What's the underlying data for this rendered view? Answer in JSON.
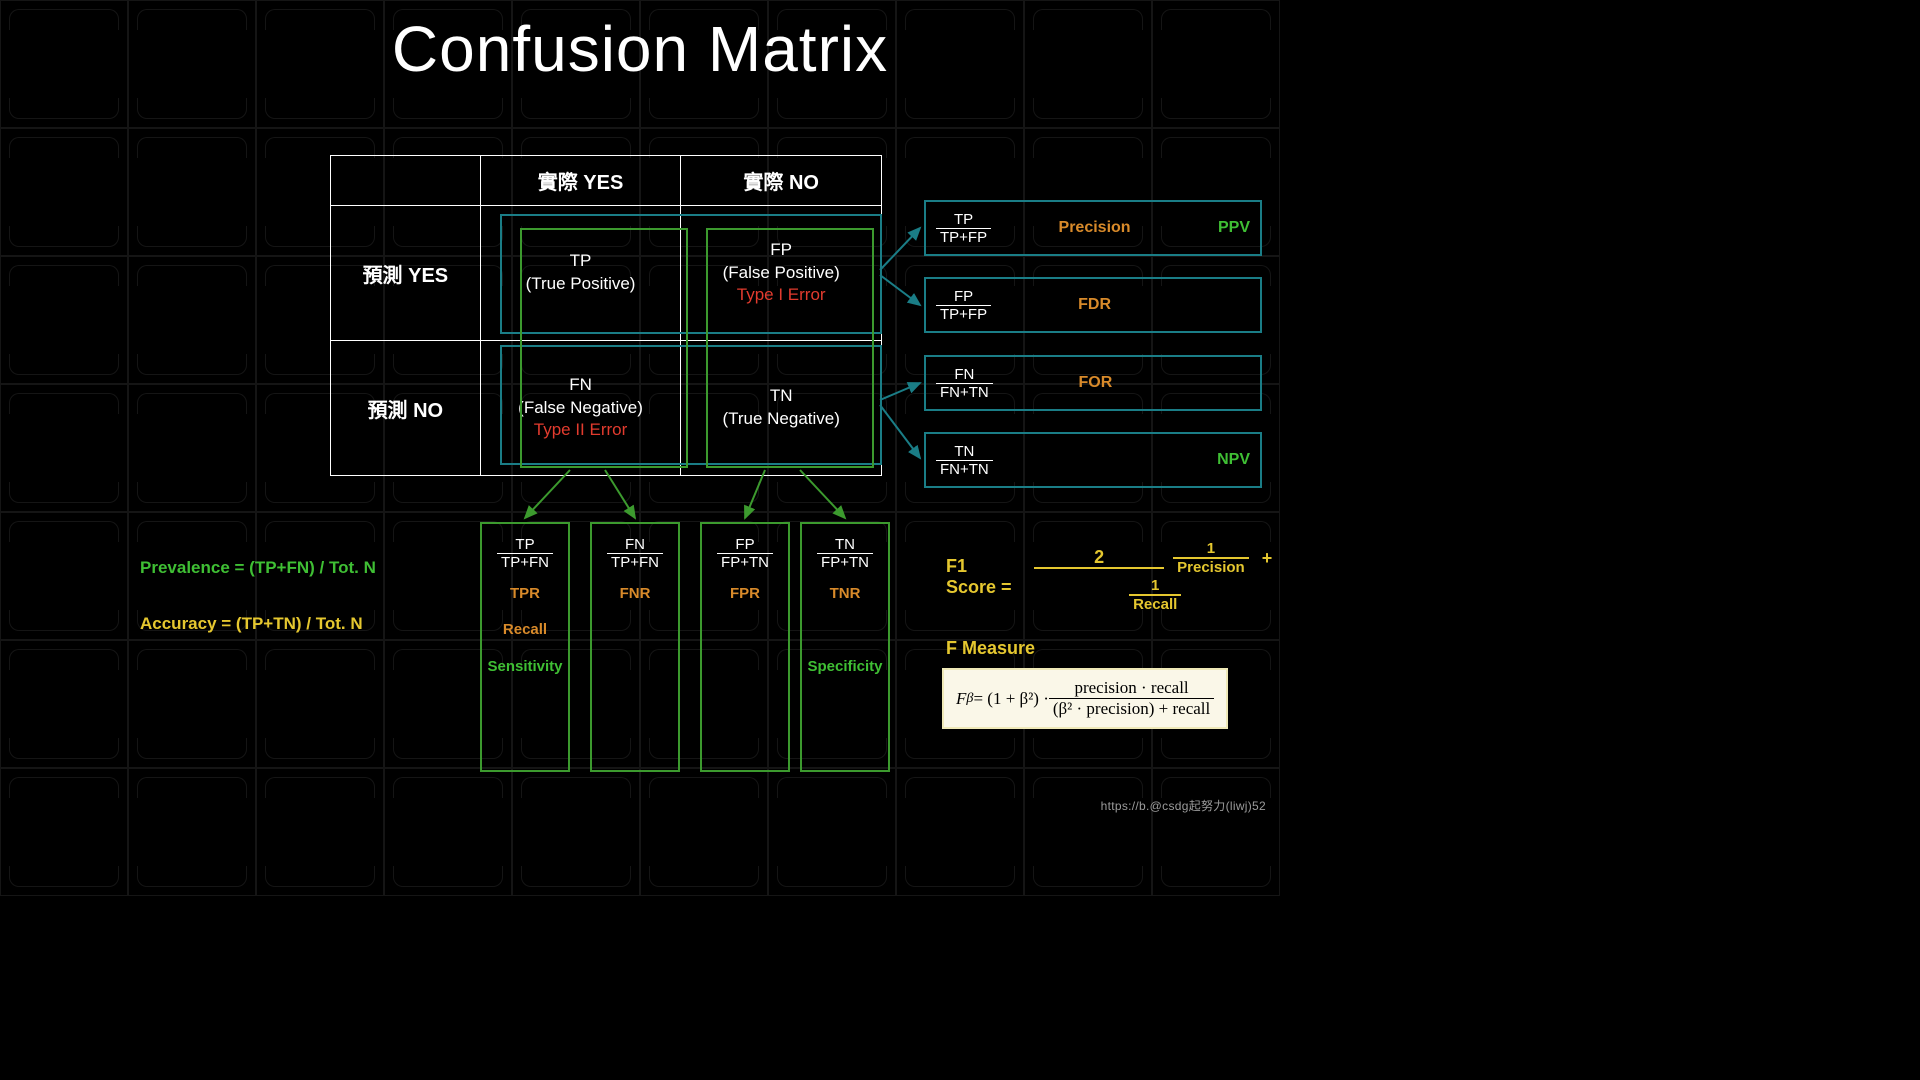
{
  "title": "Confusion Matrix",
  "matrix": {
    "col_headers": [
      "實際 YES",
      "實際 NO"
    ],
    "row_headers": [
      "預測 YES",
      "預測 NO"
    ],
    "cells": {
      "tp_abbr": "TP",
      "tp_full": "(True Positive)",
      "fp_abbr": "FP",
      "fp_full": "(False Positive)",
      "fp_err": "Type I Error",
      "fn_abbr": "FN",
      "fn_full": "(False Negative)",
      "fn_err": "Type II Error",
      "tn_abbr": "TN",
      "tn_full": "(True Negative)"
    }
  },
  "col_metrics": [
    {
      "num": "TP",
      "den": "TP+FN",
      "abbr": "TPR",
      "alt1": "Recall",
      "alt2": "Sensitivity"
    },
    {
      "num": "FN",
      "den": "TP+FN",
      "abbr": "FNR",
      "alt1": "",
      "alt2": ""
    },
    {
      "num": "FP",
      "den": "FP+TN",
      "abbr": "FPR",
      "alt1": "",
      "alt2": ""
    },
    {
      "num": "TN",
      "den": "FP+TN",
      "abbr": "TNR",
      "alt1": "",
      "alt2": "Specificity"
    }
  ],
  "row_metrics": [
    {
      "num": "TP",
      "den": "TP+FP",
      "name": "Precision",
      "name2": "PPV"
    },
    {
      "num": "FP",
      "den": "TP+FP",
      "name": "FDR",
      "name2": ""
    },
    {
      "num": "FN",
      "den": "FN+TN",
      "name": "FOR",
      "name2": ""
    },
    {
      "num": "TN",
      "den": "FN+TN",
      "name": "",
      "name2": "NPV"
    }
  ],
  "side_formulas": {
    "prevalence": "Prevalence = (TP+FN) / Tot. N",
    "accuracy": "Accuracy = (TP+TN) / Tot. N"
  },
  "f1": {
    "label": "F1 Score =",
    "numerator": "2",
    "left_num": "1",
    "left_den": "Precision",
    "right_num": "1",
    "right_den": "Recall",
    "plus": "+"
  },
  "fmeasure": {
    "label": "F Measure",
    "lhs": "F",
    "sub": "β",
    "eq": " = (1 + β²) · ",
    "num": "precision · recall",
    "den": "(β² · precision) + recall"
  },
  "watermark": "https://b.@csdg起努力(liwj)52"
}
